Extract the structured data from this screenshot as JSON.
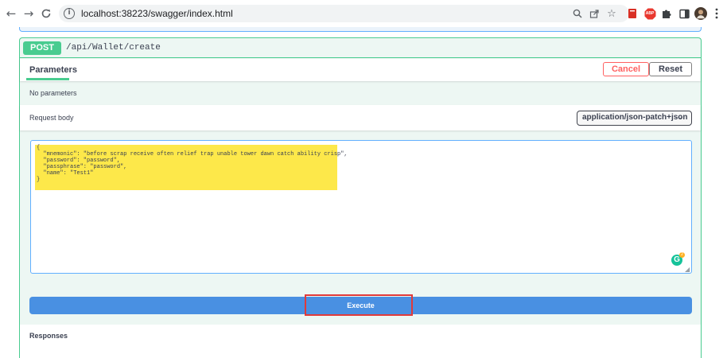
{
  "browser": {
    "url": "localhost:38223/swagger/index.html",
    "icons": {
      "back": "back-arrow-icon",
      "forward": "forward-arrow-icon",
      "reload": "reload-icon",
      "site_info": "info-icon",
      "zoom": "zoom-icon",
      "share": "share-icon",
      "bookmark": "star-icon",
      "extensions": [
        "bookmark-ext-icon",
        "abp-icon",
        "puzzle-icon",
        "side-panel-icon",
        "profile-avatar",
        "kebab-menu-icon"
      ]
    },
    "abp_label": "ABP",
    "info_glyph": "i"
  },
  "operation": {
    "method": "POST",
    "path": "/api/Wallet/create",
    "method_color": "#49cc90"
  },
  "parameters": {
    "tab_label": "Parameters",
    "cancel_label": "Cancel",
    "reset_label": "Reset",
    "empty_text": "No parameters"
  },
  "request_body": {
    "title": "Request body",
    "content_type": "application/json-patch+json",
    "code_lines": [
      "{",
      "  \"mnemonic\": \"before scrap receive often relief trap unable tower dawn catch ability crisp\",",
      "  \"password\": \"password\",",
      "  \"passphrase\": \"password\",",
      "  \"name\": \"Test1\"",
      "}"
    ],
    "highlight_color": "#fde84a",
    "grammarly_badge": "2",
    "grammarly_glyph": "G"
  },
  "execute": {
    "label": "Execute",
    "color": "#4990e2",
    "focus_outline_color": "#e03a3a"
  },
  "responses": {
    "title": "Responses"
  }
}
